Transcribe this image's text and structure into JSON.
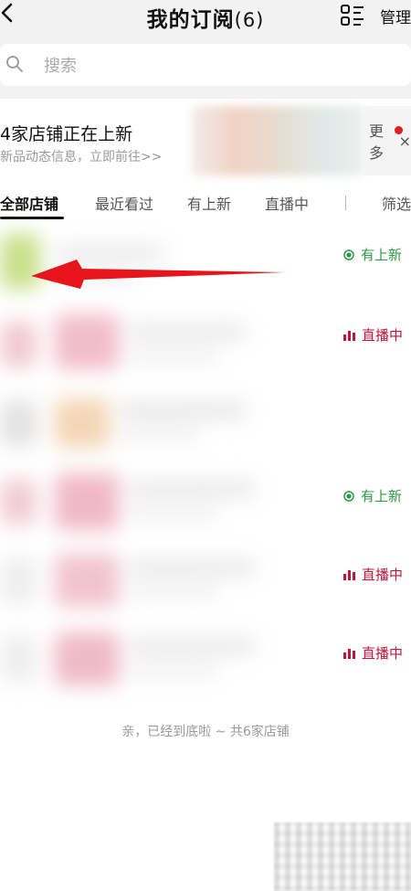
{
  "header": {
    "back_icon": "chevron-left-icon",
    "title": "我的订阅",
    "count": "(6)",
    "manage_icon": "manage-list-icon",
    "manage_label": "管理"
  },
  "search": {
    "placeholder": "搜索"
  },
  "banner": {
    "title": "4家店铺正在上新",
    "subtitle": "新品动态信息，立即前往>>",
    "more_label": "更多",
    "more_close": "×"
  },
  "tabs": [
    {
      "label": "全部店铺",
      "active": true
    },
    {
      "label": "最近看过",
      "active": false
    },
    {
      "label": "有上新",
      "active": false
    },
    {
      "label": "直播中",
      "active": false
    },
    {
      "label": "筛选",
      "active": false
    }
  ],
  "shops": [
    {
      "status": "有上新",
      "status_type": "new"
    },
    {
      "status": "直播中",
      "status_type": "live"
    },
    {
      "status": "",
      "status_type": "none"
    },
    {
      "status": "有上新",
      "status_type": "new"
    },
    {
      "status": "直播中",
      "status_type": "live"
    },
    {
      "status": "直播中",
      "status_type": "live"
    }
  ],
  "footer": {
    "note": "亲，已经到底啦 ~ 共6家店铺"
  },
  "colors": {
    "new_status": "#2e9a45",
    "live_status": "#c0143c",
    "arrow": "#e8141c",
    "badge_dot": "#e02020"
  }
}
